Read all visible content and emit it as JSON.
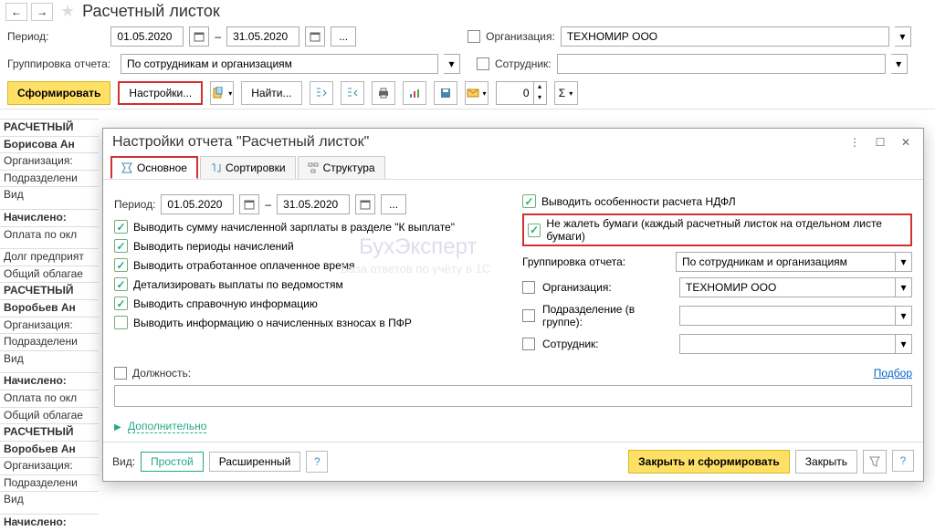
{
  "header": {
    "title": "Расчетный листок"
  },
  "period": {
    "label": "Период:",
    "from": "01.05.2020",
    "dash": "–",
    "to": "31.05.2020"
  },
  "org": {
    "label": "Организация:",
    "value": "ТЕХНОМИР ООО"
  },
  "grouping": {
    "label": "Группировка отчета:",
    "value": "По сотрудникам и организациям"
  },
  "employee": {
    "label": "Сотрудник:"
  },
  "toolbar": {
    "form": "Сформировать",
    "settings": "Настройки...",
    "find": "Найти...",
    "spin": "0"
  },
  "bg": {
    "l1": "РАСЧЕТНЫЙ",
    "l2": "Борисова Ан",
    "l3": "Организация:",
    "l4": "Подразделени",
    "l5": "Вид",
    "l6": "Начислено:",
    "l7": "Оплата по окл",
    "l8": "Долг предприят",
    "l9": "Общий облагае",
    "l10": "РАСЧЕТНЫЙ",
    "l11": "Воробьев Ан",
    "l12": "Организация:",
    "l13": "Подразделени",
    "l14": "Вид",
    "l15": "Начислено:",
    "l16": "Оплата по окл",
    "l17": "Общий облагае",
    "l18": "РАСЧЕТНЫЙ",
    "l19": "Воробьев Ан",
    "l20": "Организация:",
    "l21": "Подразделени",
    "l22": "Вид",
    "l23": "Начислено:"
  },
  "modal": {
    "title": "Настройки отчета \"Расчетный листок\"",
    "tabs": {
      "main": "Основное",
      "sort": "Сортировки",
      "struct": "Структура"
    },
    "period_label": "Период:",
    "period_from": "01.05.2020",
    "period_to": "31.05.2020",
    "left_checks": [
      "Выводить сумму начисленной зарплаты в разделе \"К выплате\"",
      "Выводить периоды начислений",
      "Выводить отработанное оплаченное время",
      "Детализировать выплаты по ведомостям",
      "Выводить справочную информацию",
      "Выводить информацию о начисленных взносах в ПФР"
    ],
    "right_checks": [
      "Выводить особенности расчета НДФЛ",
      "Не жалеть бумаги (каждый расчетный листок на отдельном листе бумаги)"
    ],
    "r_grouping_label": "Группировка отчета:",
    "r_grouping_value": "По сотрудникам и организациям",
    "r_org_label": "Организация:",
    "r_org_value": "ТЕХНОМИР ООО",
    "r_dept_label": "Подразделение (в группе):",
    "r_emp_label": "Сотрудник:",
    "position_label": "Должность:",
    "selection_link": "Подбор",
    "more": "Дополнительно",
    "view_label": "Вид:",
    "view_simple": "Простой",
    "view_adv": "Расширенный",
    "close_form": "Закрыть и сформировать",
    "close": "Закрыть"
  }
}
